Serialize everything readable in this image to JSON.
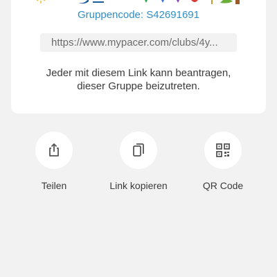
{
  "group": {
    "code_text": "Gruppencode: S42691691",
    "link": "https://www.mypacer.com/clubs/4y...",
    "info_line1": "Jeder mit diesem Link kann beantragen,",
    "info_line2": "dieser Gruppe beizutreten."
  },
  "actions": {
    "share_label": "Teilen",
    "copy_label": "Link kopieren",
    "qr_label": "QR Code"
  },
  "colors": {
    "accent": "#2f8ec9",
    "background": "#f2f2f2",
    "card": "#ffffff"
  }
}
